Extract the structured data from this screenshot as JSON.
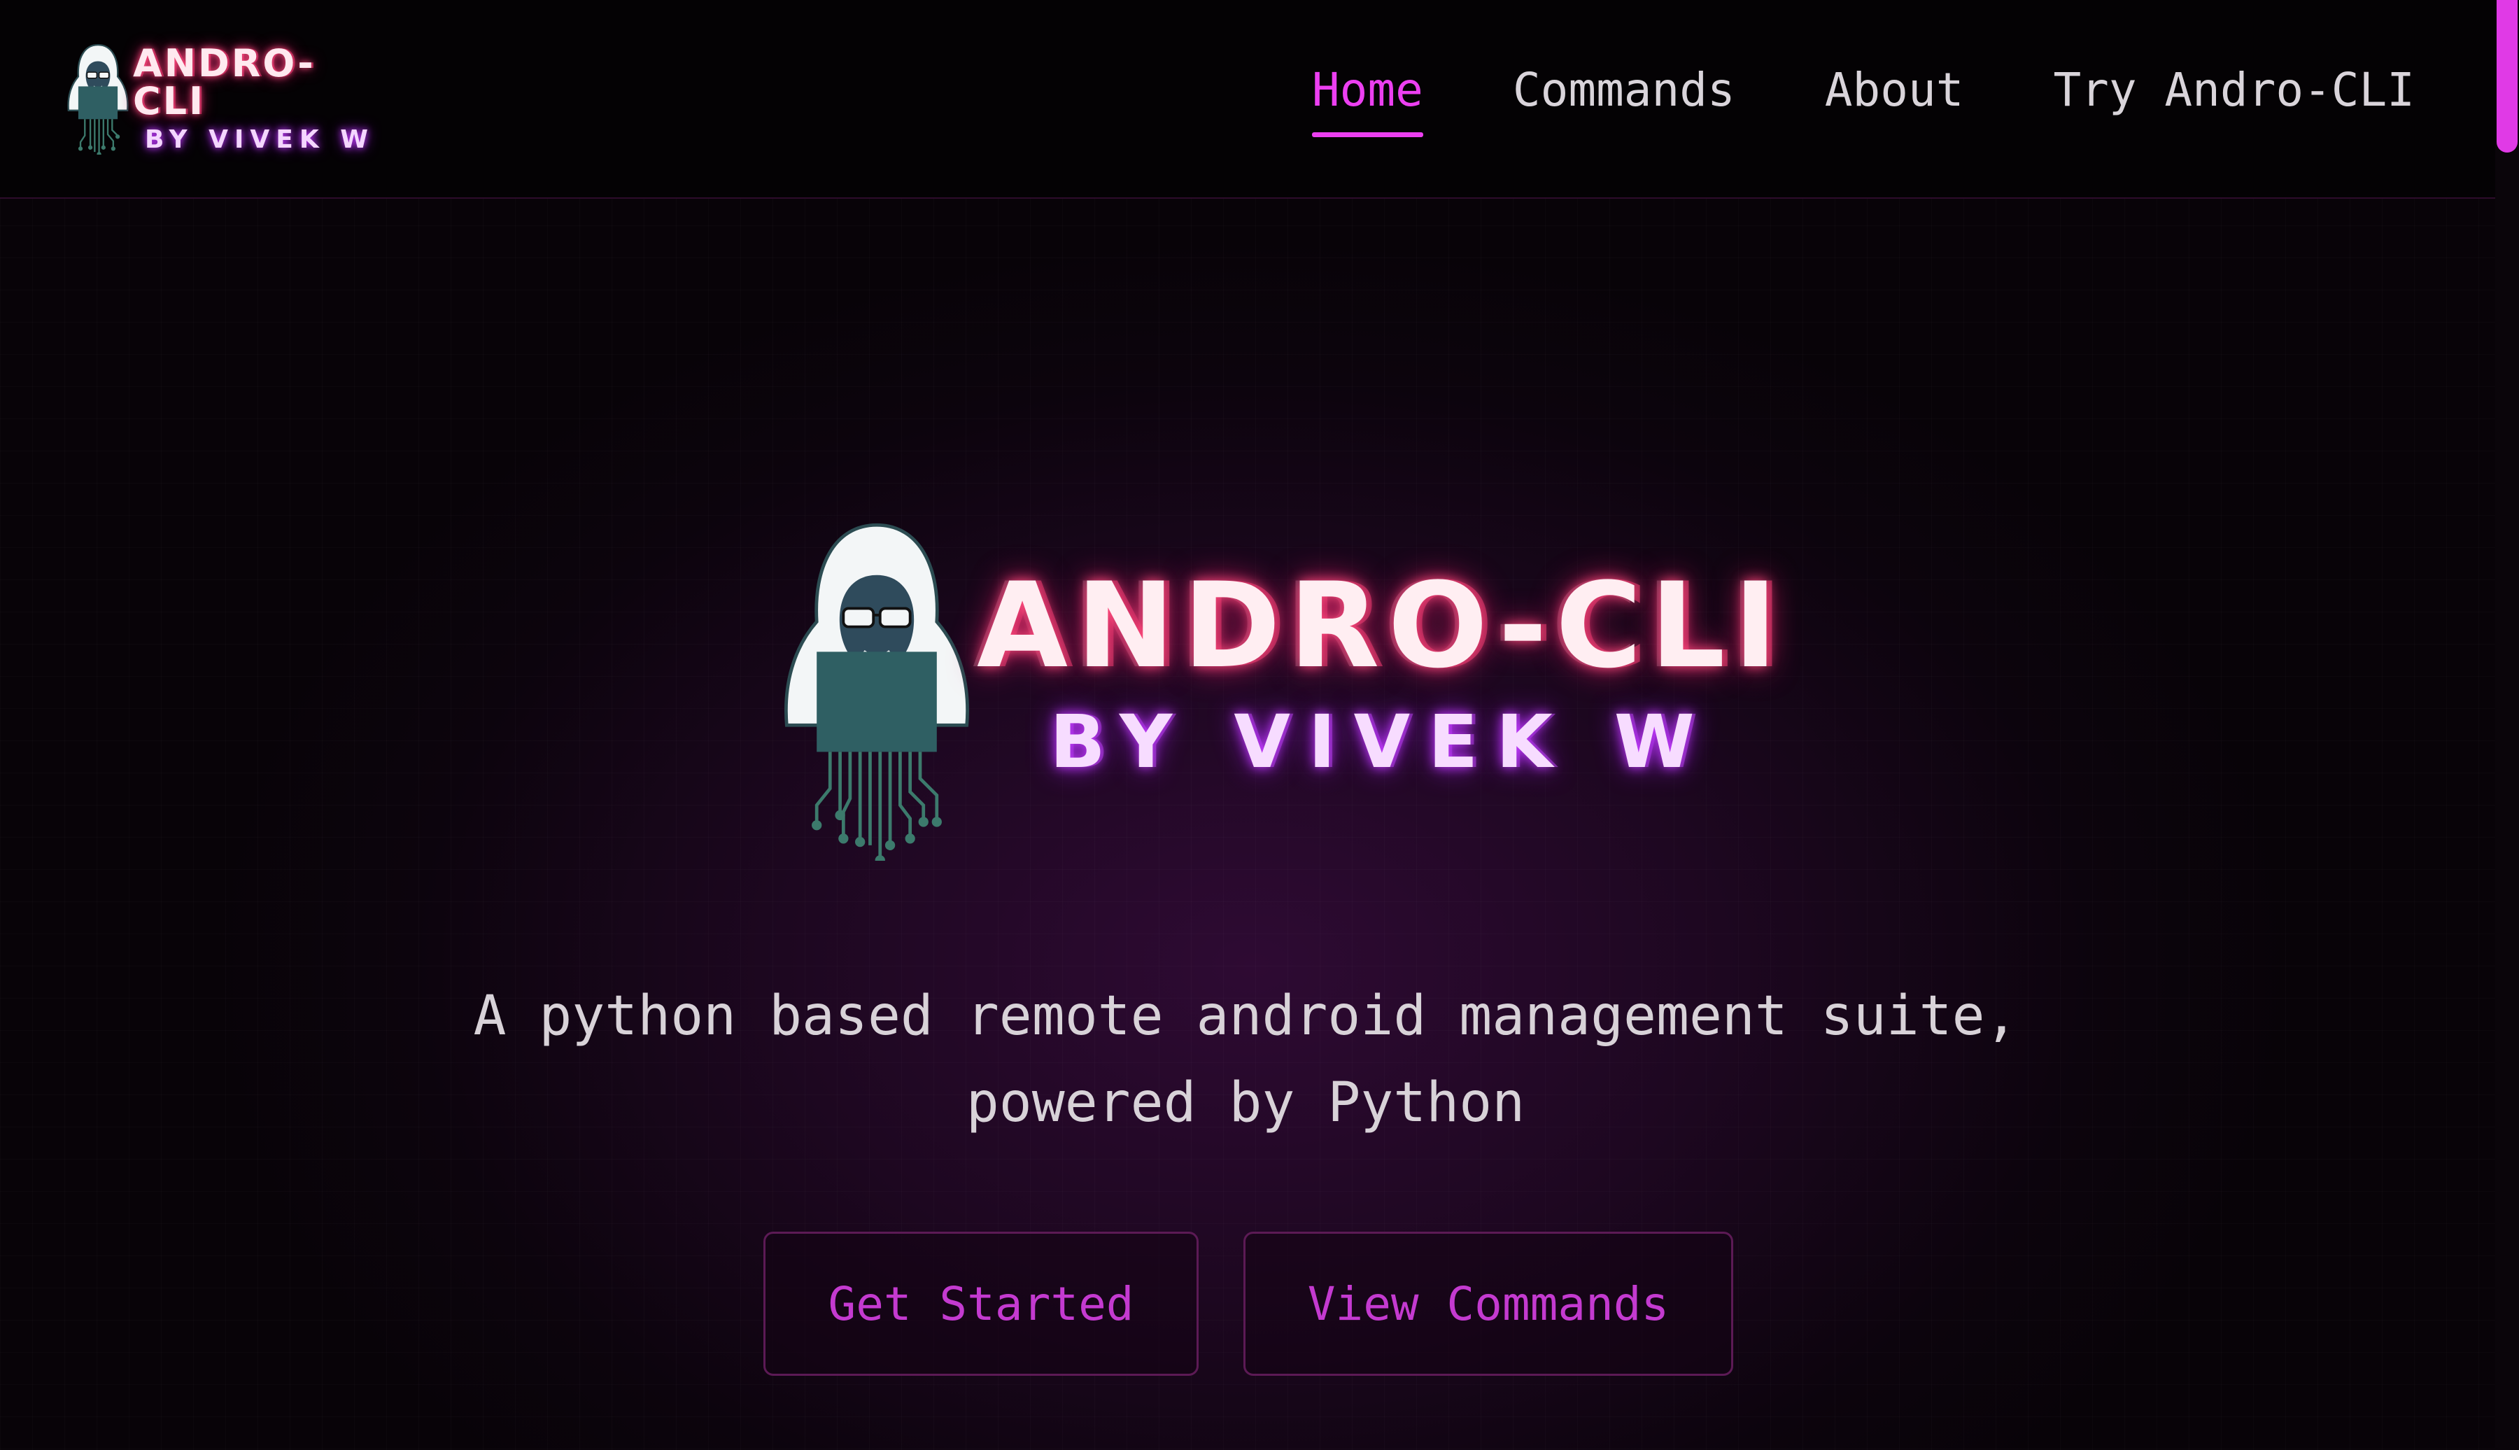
{
  "brand": {
    "logo_main": "ANDRO-CLI",
    "logo_sub": "BY VIVEK W"
  },
  "nav": {
    "items": [
      {
        "label": "Home",
        "active": true
      },
      {
        "label": "Commands",
        "active": false
      },
      {
        "label": "About",
        "active": false
      },
      {
        "label": "Try Andro-CLI",
        "active": false
      }
    ]
  },
  "hero": {
    "logo_main": "ANDRO-CLI",
    "logo_sub": "BY VIVEK W",
    "tagline_line1": "A python based remote android management suite,",
    "tagline_line2": "powered by Python",
    "primary_button": "Get Started",
    "secondary_button": "View Commands"
  },
  "colors": {
    "accent": "#ec3ff1",
    "background": "#070307",
    "button_text": "#c43ad0",
    "button_border": "#5c1a55",
    "hacker_fill": "#2f5f63"
  },
  "icons": {
    "logo_figure": "hooded-hacker-icon",
    "circuit": "circuit-traces-icon"
  }
}
